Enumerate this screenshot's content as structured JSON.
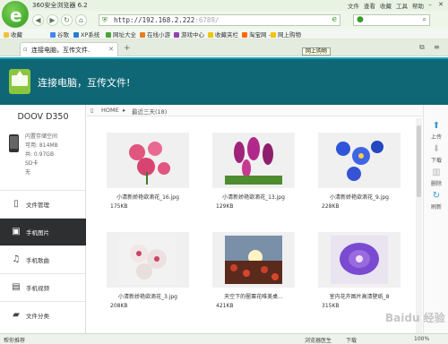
{
  "browser": {
    "title": "360安全浏览器 6.2",
    "menu": [
      "文件",
      "查看",
      "收藏",
      "工具",
      "帮助"
    ],
    "url_host": "http://192.168.2.222",
    "url_port": ":6789/",
    "favorites_label": "收藏",
    "favorites": [
      "谷歌",
      "XP系统",
      "网址大全",
      "在线小游",
      "游戏中心",
      "收藏夹栏",
      "淘宝网 -",
      "网上购物"
    ],
    "tab_label": "连接电脑，互传文件.",
    "tooltip": "网上购物",
    "status_left": "帮你推荐",
    "status_speed": "浏览器医生",
    "status_download": "下载",
    "zoom": "100%"
  },
  "banner": {
    "title": "连接电脑，互传文件!"
  },
  "device": {
    "name": "DOOV D350",
    "storage_label": "内置存储空间",
    "available": "可用: 814MB",
    "total": "共: 0.97GB",
    "sd_label": "SD卡",
    "sd_value": "无"
  },
  "menu": [
    {
      "label": "文件管理",
      "icon": "phone-icon"
    },
    {
      "label": "手机图片",
      "icon": "image-icon"
    },
    {
      "label": "手机歌曲",
      "icon": "music-icon"
    },
    {
      "label": "手机视频",
      "icon": "video-icon"
    },
    {
      "label": "文件分类",
      "icon": "folder-icon"
    }
  ],
  "breadcrumb": {
    "home": "HOME",
    "current": "最近三天(18)"
  },
  "photos": [
    {
      "name": "小清新娇艳欲滴花_16.jpg",
      "size": "175KB",
      "color": "#e0567f"
    },
    {
      "name": "小清新娇艳欲滴花_13.jpg",
      "size": "129KB",
      "color": "#a0237a"
    },
    {
      "name": "小清新娇艳欲滴花_9.jpg",
      "size": "228KB",
      "color": "#2f56d8"
    },
    {
      "name": "小清新娇艳欲滴花_3.jpg",
      "size": "208KB",
      "color": "#e9dede"
    },
    {
      "name": "天空下的罂粟花唯美桌...",
      "size": "421KB",
      "color": "#c9402a"
    },
    {
      "name": "室内花卉图片高清壁纸_8",
      "size": "315KB",
      "color": "#7a4ad0"
    }
  ],
  "tools": [
    {
      "label": "上传",
      "icon": "upload-icon"
    },
    {
      "label": "下载",
      "icon": "download-icon"
    },
    {
      "label": "删除",
      "icon": "delete-icon"
    },
    {
      "label": "刷新",
      "icon": "refresh-icon"
    }
  ],
  "watermark": "Baidu 经验"
}
